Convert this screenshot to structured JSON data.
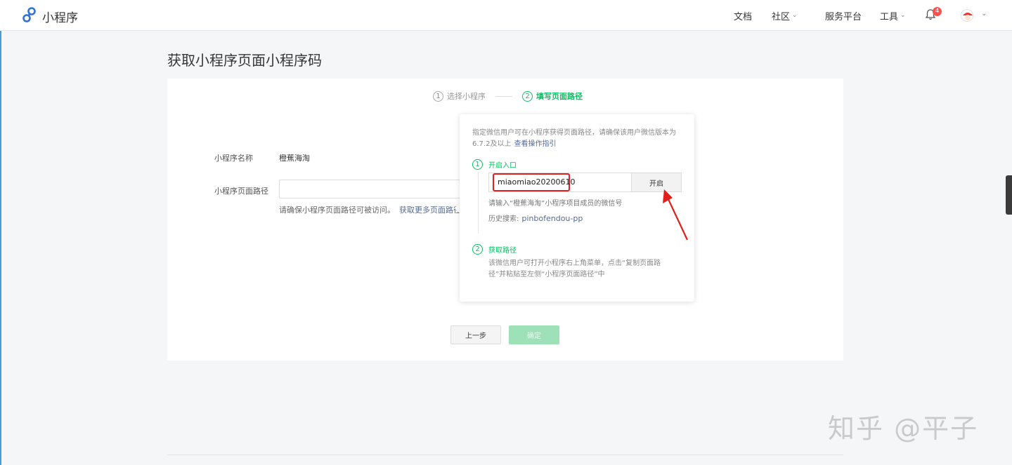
{
  "header": {
    "app_name": "小程序",
    "nav": {
      "docs": "文档",
      "community": "社区",
      "service": "服务平台",
      "tools": "工具"
    },
    "notification_count": "4"
  },
  "page": {
    "title": "获取小程序页面小程序码"
  },
  "steps": [
    {
      "num": "1",
      "label": "选择小程序"
    },
    {
      "num": "2",
      "label": "填写页面路径"
    }
  ],
  "form": {
    "name_label": "小程序名称",
    "name_value": "橙蕉海淘",
    "path_label": "小程序页面路径",
    "path_value": "",
    "hint_text": "请确保小程序页面路径可被访问。",
    "hint_link": "获取更多页面路径"
  },
  "popover": {
    "desc": "指定微信用户可在小程序获得页面路径，请确保该用户微信版本为6.7.2及以上",
    "guide_link": "查看操作指引",
    "step1_num": "1",
    "step1_title": "开启入口",
    "wechat_id_value": "miaomiao20200610",
    "open_button": "开启",
    "wechat_hint": "请输入“橙蕉海淘”小程序项目成员的微信号",
    "history_label": "历史搜索:",
    "history_value": "pinbofendou-pp",
    "step2_num": "2",
    "step2_title": "获取路径",
    "step2_desc": "该微信用户可打开小程序右上角菜单，点击“复制页面路径”并粘贴至左侧“小程序页面路径”中"
  },
  "buttons": {
    "prev": "上一步",
    "confirm": "确定"
  },
  "watermark": "知乎 @平子",
  "colors": {
    "accent_green": "#07c160",
    "link_blue": "#576b95",
    "highlight_red": "#e0201c"
  }
}
